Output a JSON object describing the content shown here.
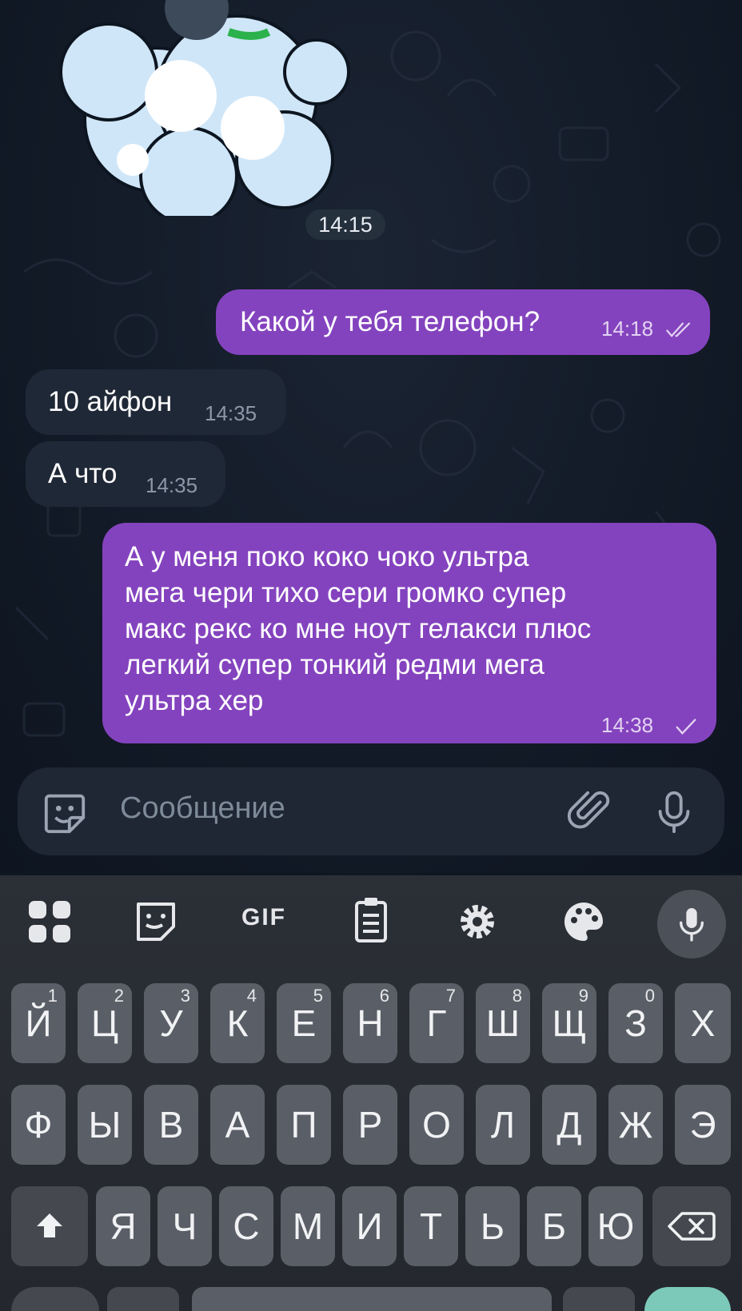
{
  "chat": {
    "sticker_time": "14:15",
    "messages": [
      {
        "direction": "out",
        "text": "Какой у тебя телефон?",
        "time": "14:18",
        "status": "read"
      },
      {
        "direction": "in",
        "text": "10 айфон",
        "time": "14:35"
      },
      {
        "direction": "in",
        "text": "А что",
        "time": "14:35"
      },
      {
        "direction": "out",
        "lines": [
          "А у меня поко коко чоко ультра",
          "мега чери тихо сери громко супер",
          "макс рекс ко мне ноут гелакси плюс",
          "легкий супер тонкий редми мега",
          "ультра хер"
        ],
        "time": "14:38",
        "status": "sent"
      }
    ]
  },
  "input": {
    "placeholder": "Сообщение",
    "icons": [
      "sticker-icon",
      "paperclip-icon",
      "microphone-icon"
    ]
  },
  "keyboard": {
    "toolbar": {
      "gif_label": "GIF"
    },
    "row1": [
      {
        "label": "Й",
        "hint": "1"
      },
      {
        "label": "Ц",
        "hint": "2"
      },
      {
        "label": "У",
        "hint": "3"
      },
      {
        "label": "К",
        "hint": "4"
      },
      {
        "label": "Е",
        "hint": "5"
      },
      {
        "label": "Н",
        "hint": "6"
      },
      {
        "label": "Г",
        "hint": "7"
      },
      {
        "label": "Ш",
        "hint": "8"
      },
      {
        "label": "Щ",
        "hint": "9"
      },
      {
        "label": "З",
        "hint": "0"
      },
      {
        "label": "Х",
        "hint": ""
      }
    ],
    "row2": [
      "Ф",
      "Ы",
      "В",
      "А",
      "П",
      "Р",
      "О",
      "Л",
      "Д",
      "Ж",
      "Э"
    ],
    "row3": [
      "Я",
      "Ч",
      "С",
      "М",
      "И",
      "Т",
      "Ь",
      "Б",
      "Ю"
    ]
  },
  "colors": {
    "outgoing": "#8443be",
    "incoming": "#1f2836",
    "key": "#5a5e66"
  }
}
